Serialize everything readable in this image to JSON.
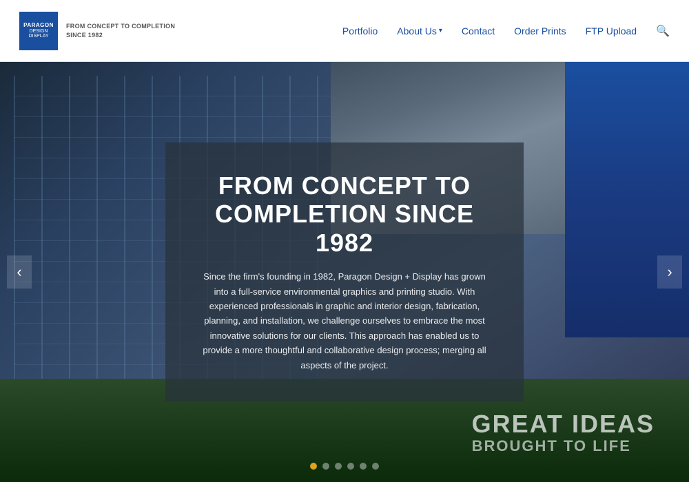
{
  "header": {
    "logo": {
      "line1": "PARAGON",
      "line2": "DESIGN",
      "line3": "DISPLAY",
      "tagline_line1": "FROM CONCEPT TO COMPLETION",
      "tagline_line2": "SINCE 1982"
    },
    "nav": {
      "portfolio": "Portfolio",
      "about_us": "About Us",
      "contact": "Contact",
      "order_prints": "Order Prints",
      "ftp_upload": "FTP Upload"
    }
  },
  "hero": {
    "title": "FROM CONCEPT TO\nCOMPLETION SINCE 1982",
    "body": "Since the firm's founding in 1982, Paragon Design + Display has grown into a full-service environmental graphics and printing studio. With experienced professionals in graphic and interior design, fabrication, planning, and installation, we challenge ourselves to embrace the most innovative solutions for our clients. This approach has enabled us to provide a more thoughtful and collaborative design process; merging all aspects of the project.",
    "arrow_left": "‹",
    "arrow_right": "›",
    "sign_line1": "GREAT IDEAS",
    "sign_line2": "BROUGHT to LIFE",
    "dots": [
      {
        "active": true
      },
      {
        "active": false
      },
      {
        "active": false
      },
      {
        "active": false
      },
      {
        "active": false
      },
      {
        "active": false
      }
    ]
  }
}
